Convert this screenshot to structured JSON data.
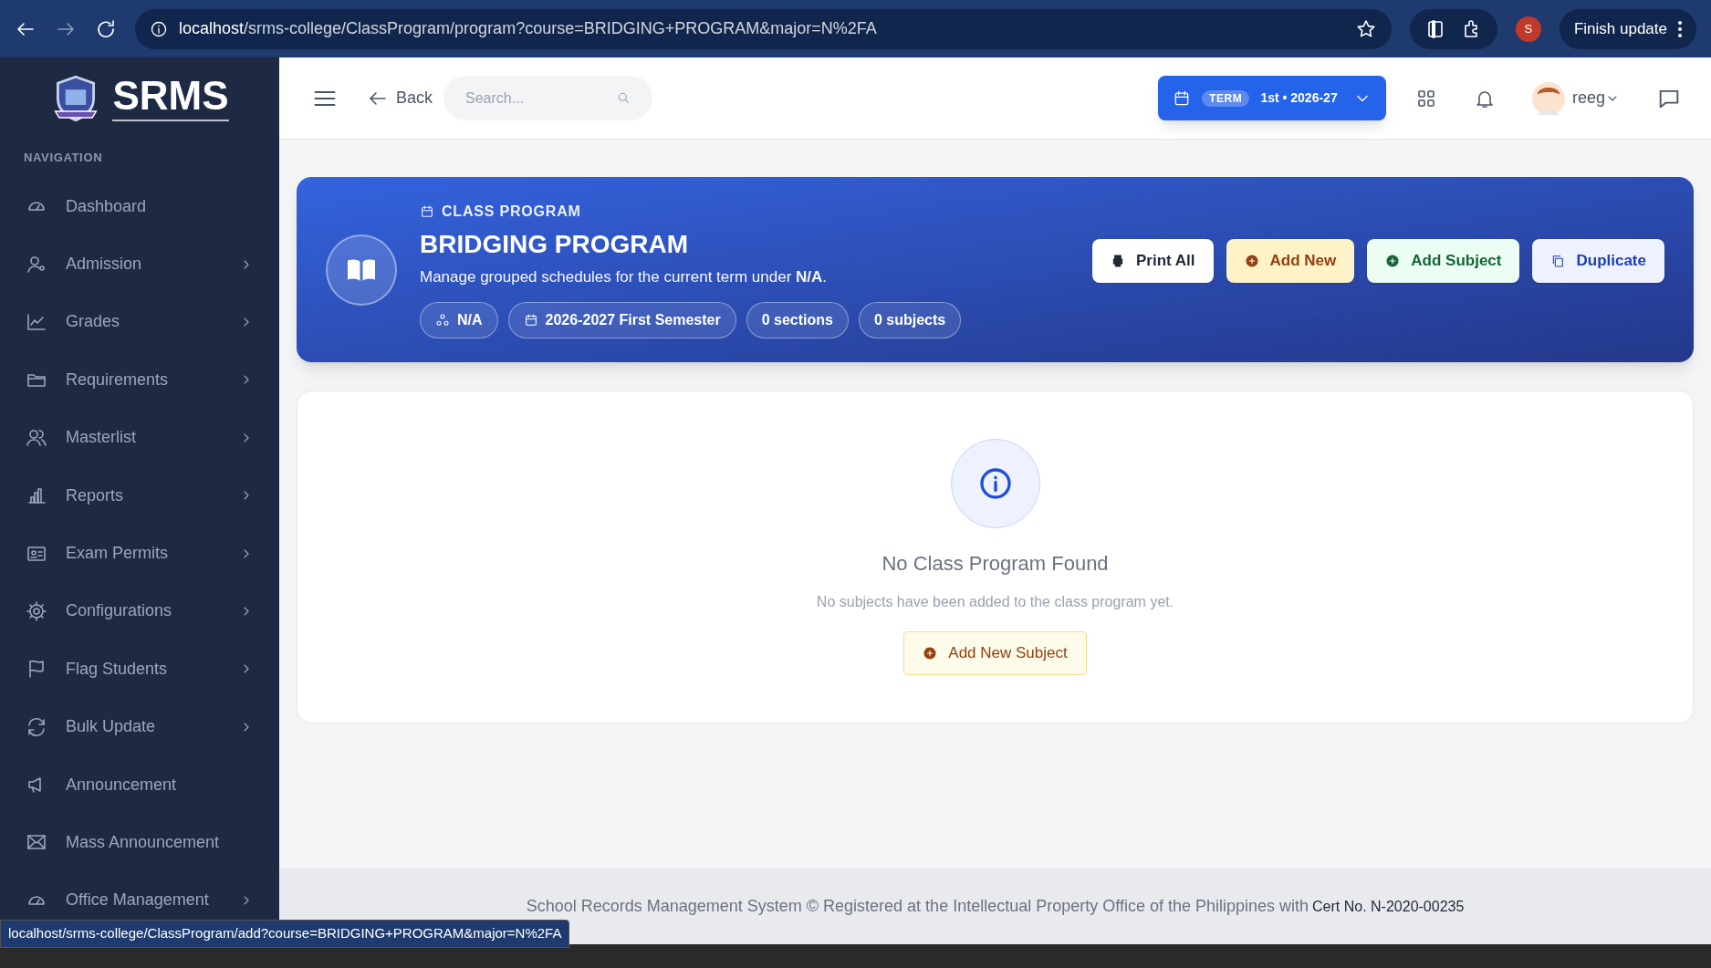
{
  "browser": {
    "url_host": "localhost",
    "url_path": "/srms-college/ClassProgram/program?course=BRIDGING+PROGRAM&major=N%2FA",
    "profile_initial": "S",
    "update_button": "Finish update"
  },
  "sidebar": {
    "logo": "SRMS",
    "section": "NAVIGATION",
    "items": [
      {
        "label": "Dashboard",
        "has_submenu": false
      },
      {
        "label": "Admission",
        "has_submenu": true
      },
      {
        "label": "Grades",
        "has_submenu": true
      },
      {
        "label": "Requirements",
        "has_submenu": true
      },
      {
        "label": "Masterlist",
        "has_submenu": true
      },
      {
        "label": "Reports",
        "has_submenu": true
      },
      {
        "label": "Exam Permits",
        "has_submenu": true
      },
      {
        "label": "Configurations",
        "has_submenu": true
      },
      {
        "label": "Flag Students",
        "has_submenu": true
      },
      {
        "label": "Bulk Update",
        "has_submenu": true
      },
      {
        "label": "Announcement",
        "has_submenu": false
      },
      {
        "label": "Mass Announcement",
        "has_submenu": false
      },
      {
        "label": "Office Management",
        "has_submenu": true
      }
    ]
  },
  "header": {
    "back": "Back",
    "search_placeholder": "Search...",
    "term_label": "TERM",
    "term_value": "1st • 2026-27",
    "user": "reeg"
  },
  "banner": {
    "eyebrow": "CLASS PROGRAM",
    "title": "BRIDGING PROGRAM",
    "description": "Manage grouped schedules for the current term under **N/A**.",
    "chips": [
      {
        "kind": "major",
        "label": "N/A"
      },
      {
        "kind": "term",
        "label": "2026-2027 First Semester"
      },
      {
        "kind": "count",
        "label": "0 sections"
      },
      {
        "kind": "count",
        "label": "0 subjects"
      }
    ],
    "actions": [
      {
        "kind": "print",
        "label": "Print All"
      },
      {
        "kind": "add",
        "label": "Add New"
      },
      {
        "kind": "subject",
        "label": "Add Subject"
      },
      {
        "kind": "duplicate",
        "label": "Duplicate"
      }
    ]
  },
  "empty_state": {
    "title": "No Class Program Found",
    "message": "No subjects have been added to the class program yet.",
    "button": "Add New Subject"
  },
  "footer": {
    "text": "School Records Management System © Registered at the Intellectual Property Office of the Philippines with",
    "cert": "Cert No. N-2020-00235"
  },
  "status_url": "localhost/srms-college/ClassProgram/add?course=BRIDGING+PROGRAM&major=N%2FA"
}
